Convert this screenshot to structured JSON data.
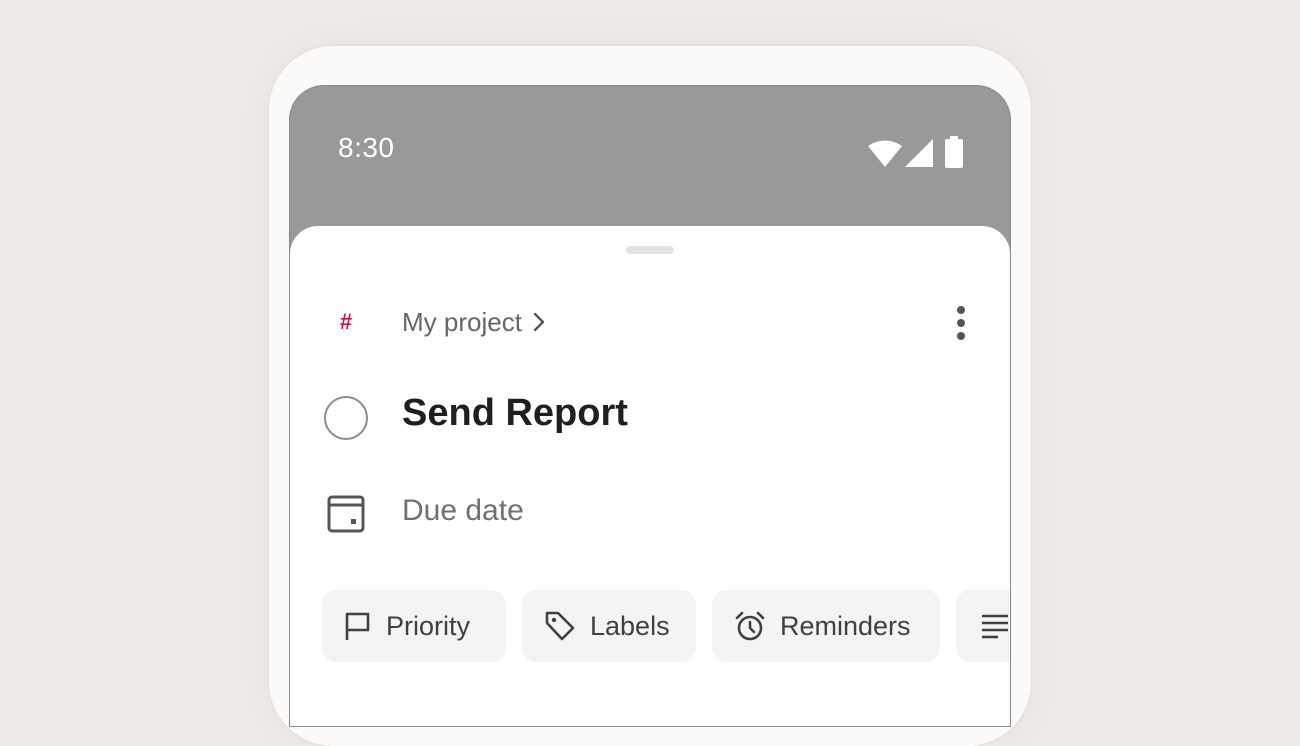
{
  "status_bar": {
    "time": "8:30",
    "icons": [
      "wifi-icon",
      "signal-icon",
      "battery-icon"
    ]
  },
  "task_sheet": {
    "project": {
      "icon": "hash-icon",
      "hash_symbol": "#",
      "hash_color": "#c2185b",
      "name": "My project"
    },
    "more_options_icon": "more-vertical-icon",
    "task": {
      "title": "Send Report",
      "completed": false
    },
    "due_date": {
      "icon": "calendar-icon",
      "label": "Due date"
    },
    "chips": [
      {
        "icon": "flag-icon",
        "label": "Priority"
      },
      {
        "icon": "tag-icon",
        "label": "Labels"
      },
      {
        "icon": "alarm-icon",
        "label": "Reminders"
      },
      {
        "icon": "description-icon",
        "label": ""
      }
    ]
  },
  "colors": {
    "background": "#efece8",
    "status_bar": "#999999",
    "sheet": "#ffffff",
    "chip": "#f4f4f4",
    "accent": "#c2185b"
  }
}
